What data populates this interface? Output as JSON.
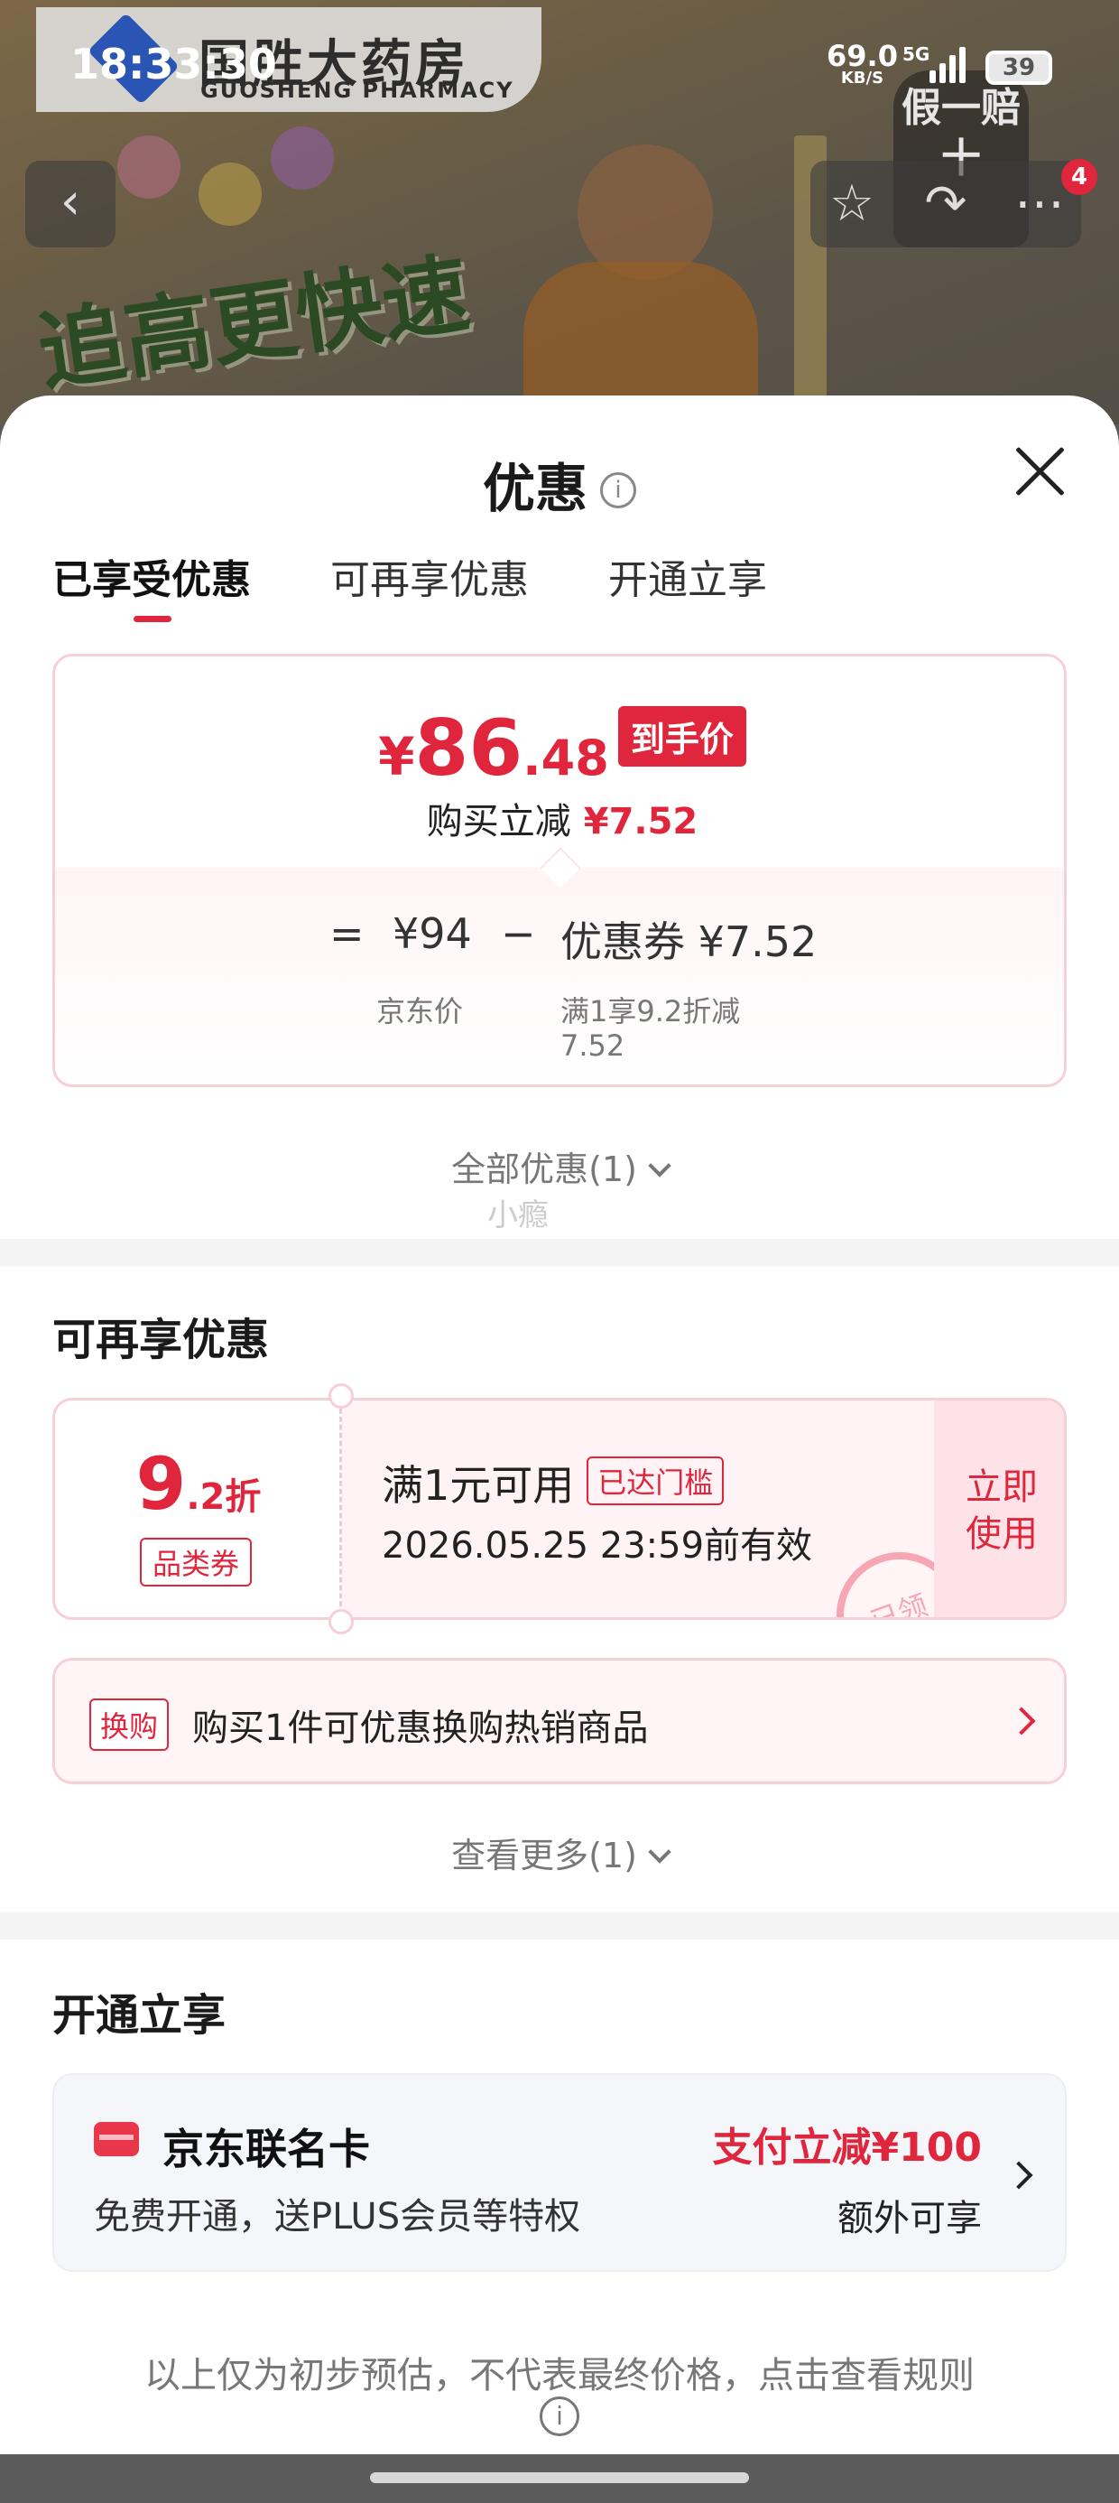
{
  "status_bar": {
    "time": "18:33:30",
    "speed_value": "69.0",
    "speed_unit": "KB/S",
    "network": "5G",
    "battery": "39"
  },
  "banner": {
    "brand_cn": "国胜大药房",
    "brand_en": "GUOSHENG PHARMACY",
    "headline": "追高更快速",
    "badge_text": "假一赔十",
    "cart_count": "4"
  },
  "sheet": {
    "title": "优惠",
    "tabs": [
      {
        "label": "已享受优惠",
        "active": true
      },
      {
        "label": "可再享优惠",
        "active": false
      },
      {
        "label": "开通立享",
        "active": false
      }
    ]
  },
  "price_card": {
    "yen": "¥",
    "price_int": "86",
    "price_dec": ".48",
    "price_tag": "到手价",
    "cut_label": "购买立减",
    "cut_value": "¥7.52",
    "eq": "=",
    "minus": "−",
    "jd_price": "¥94",
    "jd_price_label": "京东价",
    "coupon_label": "优惠券 ¥7.52",
    "coupon_desc_1": "满1享9.2折减",
    "coupon_desc_2": "7.52"
  },
  "all_discounts": "全部优惠(1)",
  "watermark": "小瘾",
  "more_discounts": {
    "title": "可再享优惠",
    "coupon": {
      "value_big": "9",
      "value_small": ".2折",
      "type": "品类券",
      "condition": "满1元可用",
      "reached": "已达门槛",
      "expiry": "2026.05.25 23:59前有效",
      "use_line1": "立即",
      "use_line2": "使用",
      "stamp": "已领"
    },
    "exchange": {
      "tag": "换购",
      "text": "购买1件可优惠换购热销商品"
    },
    "view_more": "查看更多(1)"
  },
  "open_enjoy": {
    "title": "开通立享",
    "card_name": "京东联名卡",
    "card_desc": "免费开通，送PLUS会员等特权",
    "promo": "支付立减¥100",
    "extra": "额外可享"
  },
  "footnote": "以上仅为初步预估，不代表最终价格，点击查看规则",
  "colors": {
    "accent": "#e0263c",
    "card_border": "#f7cfd6",
    "card_bg": "#fff4f6"
  }
}
